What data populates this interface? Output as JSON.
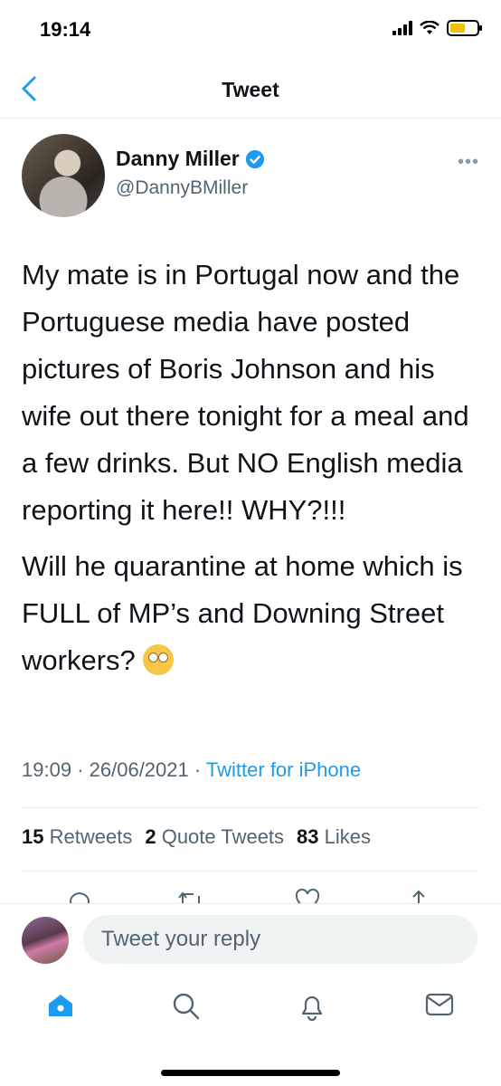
{
  "status": {
    "time": "19:14"
  },
  "nav": {
    "title": "Tweet"
  },
  "author": {
    "name": "Danny Miller",
    "handle": "@DannyBMiller"
  },
  "tweet": {
    "paragraph1": "My mate is in Portugal now and the Portuguese media have posted pictures of Boris Johnson and his wife out there tonight for a meal and a few drinks. But NO English media reporting it here!! WHY?!!!",
    "paragraph2": "Will he quarantine at home which is FULL of MP’s and Downing Street workers?",
    "emoji": "face-with-rolling-eyes"
  },
  "meta": {
    "time": "19:09",
    "sep1": "·",
    "date": "26/06/2021",
    "sep2": "·",
    "source": "Twitter for iPhone"
  },
  "stats": {
    "retweets_count": "15",
    "retweets_label": "Retweets",
    "quotes_count": "2",
    "quotes_label": "Quote Tweets",
    "likes_count": "83",
    "likes_label": "Likes"
  },
  "reply": {
    "placeholder": "Tweet your reply"
  },
  "icons": [
    "back-chevron-icon",
    "verified-icon",
    "more-icon",
    "reply-icon",
    "retweet-icon",
    "like-icon",
    "share-icon",
    "home-icon",
    "search-icon",
    "notifications-icon",
    "messages-icon"
  ],
  "colors": {
    "accent": "#1d9bf0",
    "text": "#0f1419",
    "secondary": "#536471"
  }
}
